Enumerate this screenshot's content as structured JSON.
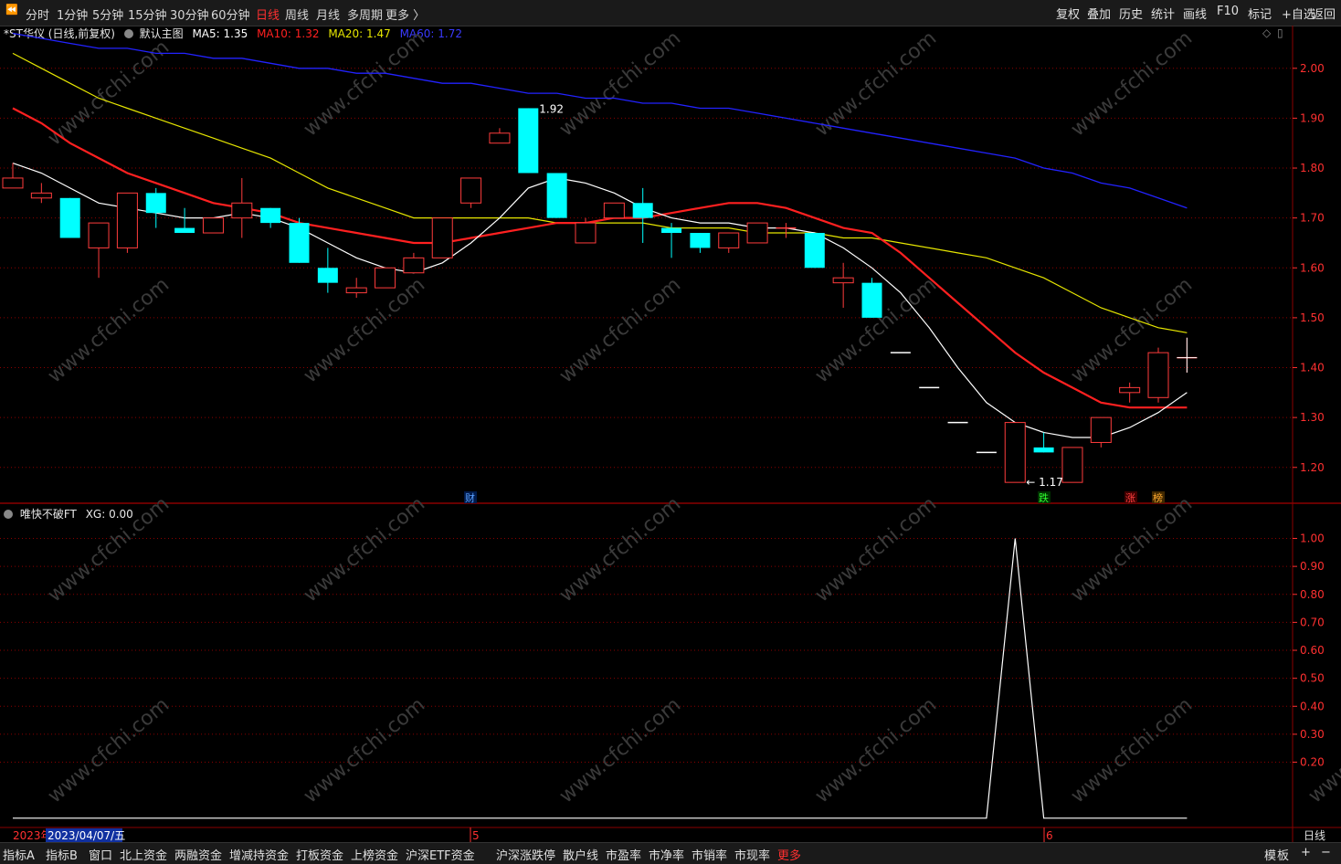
{
  "toolbar": {
    "periods": [
      "分时",
      "1分钟",
      "5分钟",
      "15分钟",
      "30分钟",
      "60分钟",
      "日线",
      "周线",
      "月线",
      "多周期",
      "更多 〉"
    ],
    "active_period": "日线",
    "right_buttons": [
      "复权",
      "叠加",
      "历史",
      "统计",
      "画线",
      "F10",
      "标记",
      "+自选",
      "返回"
    ]
  },
  "main_header": {
    "title": "*ST华仪 (日线,前复权)",
    "template": "默认主图",
    "ma5": "MA5: 1.35",
    "ma10": "MA10: 1.32",
    "ma20": "MA20: 1.47",
    "ma60": "MA60: 1.72"
  },
  "sub_header": {
    "title": "唯快不破FT",
    "xg": "XG: 0.00"
  },
  "date_cursor": {
    "year_label": "2023年",
    "date": "2023/04/07/五",
    "month_5": "5",
    "month_6": "6",
    "period_label": "日线"
  },
  "markers": {
    "cai": "财",
    "die": "跌",
    "zhang": "涨",
    "bang": "榜"
  },
  "watermark": "www.cfchi.com",
  "bottom_tabs": [
    "指标A",
    "指标B",
    "窗口",
    "北上资金",
    "两融资金",
    "增减持资金",
    "打板资金",
    "上榜资金",
    "沪深ETF资金",
    "沪深涨跌停",
    "散户线",
    "市盈率",
    "市净率",
    "市销率",
    "市现率",
    "更多"
  ],
  "bottom_right": [
    "模",
    "板",
    "+",
    "−"
  ],
  "colors": {
    "up": "#ff3c3c",
    "down": "#00ffff",
    "ma5": "#ffffff",
    "ma10": "#ff2020",
    "ma20": "#e6e600",
    "ma60": "#2222ff",
    "grid": "#8b0000",
    "axis_text": "#ff3030"
  },
  "chart_data": [
    {
      "type": "candlestick",
      "title": "*ST华仪 (日线,前复权)",
      "y_ticks": [
        2.0,
        1.9,
        1.8,
        1.7,
        1.6,
        1.5,
        1.4,
        1.3,
        1.2
      ],
      "ylim": [
        1.13,
        2.06
      ],
      "annotations": {
        "high": "1.92",
        "low": "1.17"
      },
      "candles": [
        {
          "o": 1.76,
          "h": 1.81,
          "l": 1.76,
          "c": 1.78
        },
        {
          "o": 1.74,
          "h": 1.77,
          "l": 1.73,
          "c": 1.75
        },
        {
          "o": 1.74,
          "h": 1.74,
          "l": 1.66,
          "c": 1.66
        },
        {
          "o": 1.64,
          "h": 1.69,
          "l": 1.58,
          "c": 1.69
        },
        {
          "o": 1.64,
          "h": 1.75,
          "l": 1.63,
          "c": 1.75
        },
        {
          "o": 1.75,
          "h": 1.76,
          "l": 1.68,
          "c": 1.71
        },
        {
          "o": 1.68,
          "h": 1.72,
          "l": 1.67,
          "c": 1.67
        },
        {
          "o": 1.67,
          "h": 1.7,
          "l": 1.67,
          "c": 1.7
        },
        {
          "o": 1.7,
          "h": 1.78,
          "l": 1.66,
          "c": 1.73
        },
        {
          "o": 1.72,
          "h": 1.72,
          "l": 1.68,
          "c": 1.69
        },
        {
          "o": 1.69,
          "h": 1.7,
          "l": 1.61,
          "c": 1.61
        },
        {
          "o": 1.6,
          "h": 1.64,
          "l": 1.55,
          "c": 1.57
        },
        {
          "o": 1.55,
          "h": 1.58,
          "l": 1.54,
          "c": 1.56
        },
        {
          "o": 1.56,
          "h": 1.6,
          "l": 1.56,
          "c": 1.6
        },
        {
          "o": 1.59,
          "h": 1.63,
          "l": 1.59,
          "c": 1.62
        },
        {
          "o": 1.62,
          "h": 1.7,
          "l": 1.62,
          "c": 1.7
        },
        {
          "o": 1.73,
          "h": 1.78,
          "l": 1.72,
          "c": 1.78
        },
        {
          "o": 1.85,
          "h": 1.88,
          "l": 1.85,
          "c": 1.87
        },
        {
          "o": 1.92,
          "h": 1.92,
          "l": 1.79,
          "c": 1.79
        },
        {
          "o": 1.79,
          "h": 1.79,
          "l": 1.7,
          "c": 1.7
        },
        {
          "o": 1.65,
          "h": 1.7,
          "l": 1.65,
          "c": 1.69
        },
        {
          "o": 1.7,
          "h": 1.73,
          "l": 1.7,
          "c": 1.73
        },
        {
          "o": 1.73,
          "h": 1.76,
          "l": 1.65,
          "c": 1.7
        },
        {
          "o": 1.68,
          "h": 1.69,
          "l": 1.62,
          "c": 1.67
        },
        {
          "o": 1.67,
          "h": 1.67,
          "l": 1.63,
          "c": 1.64
        },
        {
          "o": 1.64,
          "h": 1.67,
          "l": 1.63,
          "c": 1.67
        },
        {
          "o": 1.65,
          "h": 1.69,
          "l": 1.65,
          "c": 1.69
        },
        {
          "o": 1.68,
          "h": 1.69,
          "l": 1.66,
          "c": 1.68
        },
        {
          "o": 1.67,
          "h": 1.67,
          "l": 1.6,
          "c": 1.6
        },
        {
          "o": 1.57,
          "h": 1.61,
          "l": 1.52,
          "c": 1.58
        },
        {
          "o": 1.57,
          "h": 1.58,
          "l": 1.5,
          "c": 1.5
        },
        {
          "o": 1.43,
          "h": 1.43,
          "l": 1.43,
          "c": 1.43
        },
        {
          "o": 1.36,
          "h": 1.36,
          "l": 1.36,
          "c": 1.36
        },
        {
          "o": 1.29,
          "h": 1.29,
          "l": 1.29,
          "c": 1.29
        },
        {
          "o": 1.23,
          "h": 1.23,
          "l": 1.23,
          "c": 1.23
        },
        {
          "o": 1.17,
          "h": 1.29,
          "l": 1.17,
          "c": 1.29
        },
        {
          "o": 1.24,
          "h": 1.27,
          "l": 1.23,
          "c": 1.23
        },
        {
          "o": 1.17,
          "h": 1.24,
          "l": 1.17,
          "c": 1.24
        },
        {
          "o": 1.25,
          "h": 1.3,
          "l": 1.24,
          "c": 1.3
        },
        {
          "o": 1.35,
          "h": 1.37,
          "l": 1.33,
          "c": 1.36
        },
        {
          "o": 1.34,
          "h": 1.44,
          "l": 1.33,
          "c": 1.43
        },
        {
          "o": 1.42,
          "h": 1.46,
          "l": 1.39,
          "c": 1.42
        }
      ],
      "ma5": [
        1.81,
        1.79,
        1.76,
        1.73,
        1.72,
        1.71,
        1.7,
        1.7,
        1.71,
        1.7,
        1.68,
        1.65,
        1.62,
        1.6,
        1.59,
        1.61,
        1.65,
        1.7,
        1.76,
        1.78,
        1.77,
        1.75,
        1.72,
        1.7,
        1.69,
        1.69,
        1.68,
        1.68,
        1.67,
        1.64,
        1.6,
        1.55,
        1.48,
        1.4,
        1.33,
        1.29,
        1.27,
        1.26,
        1.26,
        1.28,
        1.31,
        1.35
      ],
      "ma10": [
        1.92,
        1.89,
        1.85,
        1.82,
        1.79,
        1.77,
        1.75,
        1.73,
        1.72,
        1.71,
        1.69,
        1.68,
        1.67,
        1.66,
        1.65,
        1.65,
        1.66,
        1.67,
        1.68,
        1.69,
        1.69,
        1.7,
        1.7,
        1.71,
        1.72,
        1.73,
        1.73,
        1.72,
        1.7,
        1.68,
        1.67,
        1.63,
        1.58,
        1.53,
        1.48,
        1.43,
        1.39,
        1.36,
        1.33,
        1.32,
        1.32,
        1.32
      ],
      "ma20": [
        2.03,
        2.0,
        1.97,
        1.94,
        1.92,
        1.9,
        1.88,
        1.86,
        1.84,
        1.82,
        1.79,
        1.76,
        1.74,
        1.72,
        1.7,
        1.7,
        1.7,
        1.7,
        1.7,
        1.69,
        1.69,
        1.69,
        1.69,
        1.68,
        1.68,
        1.68,
        1.67,
        1.67,
        1.67,
        1.66,
        1.66,
        1.65,
        1.64,
        1.63,
        1.62,
        1.6,
        1.58,
        1.55,
        1.52,
        1.5,
        1.48,
        1.47
      ],
      "ma60": [
        2.07,
        2.06,
        2.05,
        2.04,
        2.04,
        2.03,
        2.03,
        2.02,
        2.02,
        2.01,
        2.0,
        2.0,
        1.99,
        1.99,
        1.98,
        1.97,
        1.97,
        1.96,
        1.95,
        1.95,
        1.94,
        1.94,
        1.93,
        1.93,
        1.92,
        1.92,
        1.91,
        1.9,
        1.89,
        1.88,
        1.87,
        1.86,
        1.85,
        1.84,
        1.83,
        1.82,
        1.8,
        1.79,
        1.77,
        1.76,
        1.74,
        1.72
      ]
    },
    {
      "type": "line",
      "title": "唯快不破FT",
      "series_name": "XG",
      "y_ticks": [
        1.0,
        0.9,
        0.8,
        0.7,
        0.6,
        0.5,
        0.4,
        0.3,
        0.2
      ],
      "ylim": [
        -0.03,
        1.08
      ],
      "values": [
        0,
        0,
        0,
        0,
        0,
        0,
        0,
        0,
        0,
        0,
        0,
        0,
        0,
        0,
        0,
        0,
        0,
        0,
        0,
        0,
        0,
        0,
        0,
        0,
        0,
        0,
        0,
        0,
        0,
        0,
        0,
        0,
        0,
        0,
        0,
        1,
        0,
        0,
        0,
        0,
        0,
        0
      ]
    }
  ]
}
